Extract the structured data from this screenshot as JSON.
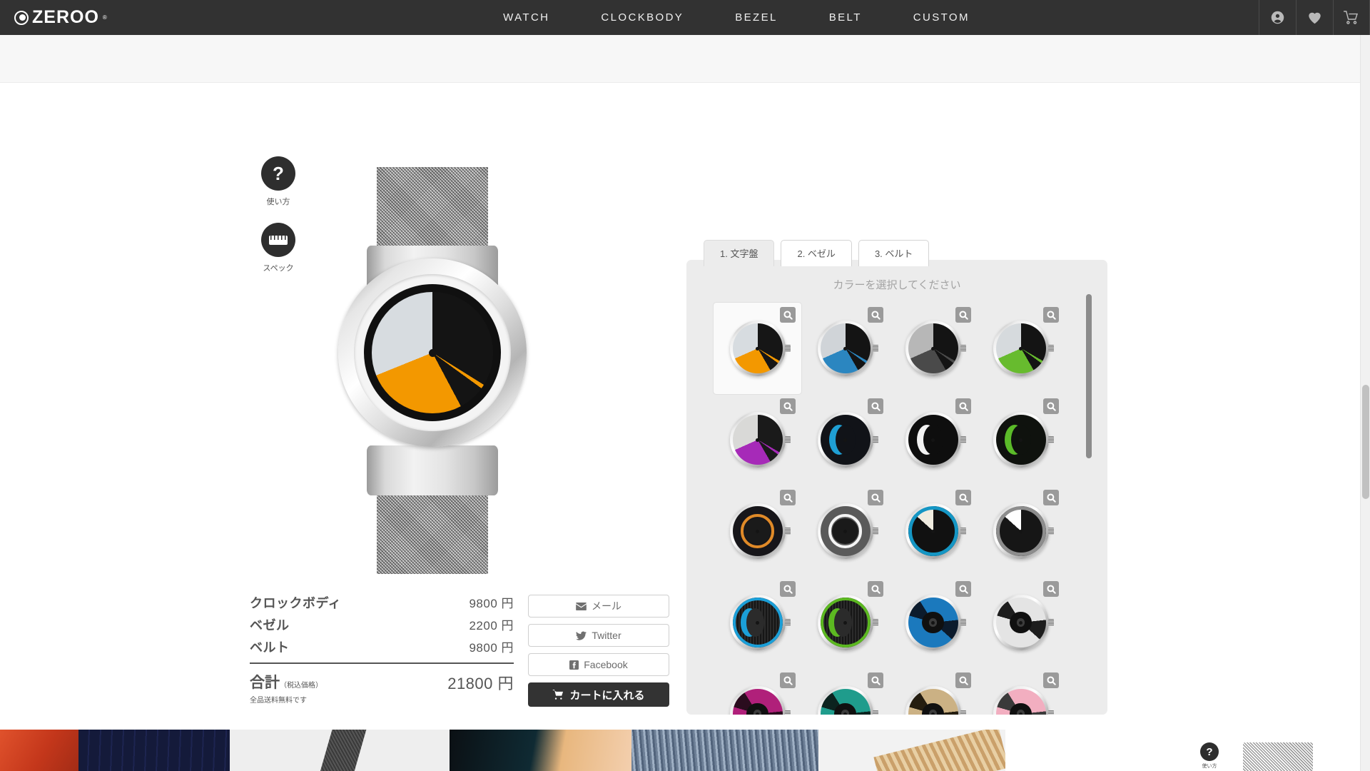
{
  "header": {
    "brand": "ZEROO",
    "brand_reg": "®",
    "nav": [
      {
        "label": "WATCH",
        "name": "nav-watch"
      },
      {
        "label": "CLOCKBODY",
        "name": "nav-clockbody"
      },
      {
        "label": "BEZEL",
        "name": "nav-bezel"
      },
      {
        "label": "BELT",
        "name": "nav-belt"
      },
      {
        "label": "CUSTOM",
        "name": "nav-custom"
      }
    ],
    "icons": [
      {
        "name": "account-icon"
      },
      {
        "name": "wishlist-heart-icon"
      },
      {
        "name": "shopping-cart-icon"
      }
    ]
  },
  "side_buttons": [
    {
      "glyph": "?",
      "label": "使い方",
      "name": "how-to-use-button"
    },
    {
      "glyph": "ruler",
      "label": "スペック",
      "name": "spec-button"
    }
  ],
  "product": {
    "dial_colors": {
      "light": "#d7dce0",
      "accent": "#f39800",
      "dark": "#141414"
    },
    "case_color": "#cfcfcf",
    "band_color": "#b0b0b0"
  },
  "pricing": {
    "rows": [
      {
        "label": "クロックボディ",
        "value": "9800 円"
      },
      {
        "label": "ベゼル",
        "value": "2200 円"
      },
      {
        "label": "ベルト",
        "value": "9800 円"
      }
    ],
    "total_label": "合計",
    "total_tax": "（税込価格）",
    "total_note": "全品送料無料です",
    "total_value": "21800 円"
  },
  "actions": {
    "share": [
      {
        "label": "メール",
        "icon": "mail-icon",
        "name": "share-mail-button"
      },
      {
        "label": "Twitter",
        "icon": "twitter-icon",
        "name": "share-twitter-button"
      },
      {
        "label": "Facebook",
        "icon": "facebook-icon",
        "name": "share-facebook-button"
      }
    ],
    "cart_label": "カートに入れる",
    "cart_icon": "cart-icon"
  },
  "selector": {
    "tabs": [
      {
        "label": "1. 文字盤",
        "name": "tab-dial",
        "active": true
      },
      {
        "label": "2. ベゼル",
        "name": "tab-bezel",
        "active": false
      },
      {
        "label": "3. ベルト",
        "name": "tab-belt",
        "active": false
      }
    ],
    "title": "カラーを選択してください",
    "swatches": [
      {
        "name": "swatch-orange-pie",
        "style": "pie",
        "accent": "#f39800",
        "light": "#d7dce0",
        "dark": "#161616",
        "selected": true
      },
      {
        "name": "swatch-blue-pie",
        "style": "pie",
        "accent": "#2b86c0",
        "light": "#d0d4d8",
        "dark": "#141414",
        "selected": false
      },
      {
        "name": "swatch-grey-pie",
        "style": "pie",
        "accent": "#4a4a4a",
        "light": "#b7b7b7",
        "dark": "#141414",
        "selected": false
      },
      {
        "name": "swatch-green-pie",
        "style": "pie",
        "accent": "#67bb2e",
        "light": "#d6dadd",
        "dark": "#141414",
        "selected": false
      },
      {
        "name": "swatch-purple-pie",
        "style": "pie",
        "accent": "#a62ab8",
        "light": "#d9d9d7",
        "dark": "#1a1a1a",
        "selected": false
      },
      {
        "name": "swatch-blue-moon",
        "style": "crescent",
        "accent": "#1f9fd4",
        "dark": "#111318",
        "selected": false
      },
      {
        "name": "swatch-white-moon",
        "style": "crescent",
        "accent": "#f2f2f2",
        "dark": "#0e0e0e",
        "selected": false
      },
      {
        "name": "swatch-green-moon",
        "style": "crescent",
        "accent": "#5bbb29",
        "dark": "#0f120e",
        "selected": false
      },
      {
        "name": "swatch-orange-ring",
        "style": "ring",
        "accent": "#e08a28",
        "dark": "#17161a",
        "selected": false
      },
      {
        "name": "swatch-white-ring",
        "style": "ring",
        "accent": "#f4f4f4",
        "dark": "#5a5a5a",
        "selected": false
      },
      {
        "name": "swatch-cyan-fan",
        "style": "fan",
        "accent": "#1596c4",
        "light": "#f0ece0",
        "dark": "#111111",
        "selected": false
      },
      {
        "name": "swatch-white-fan",
        "style": "fan",
        "accent": "#8d8d8d",
        "light": "#ffffff",
        "dark": "#161616",
        "selected": false
      },
      {
        "name": "swatch-cyan-stripe",
        "style": "stripe",
        "accent": "#1b9fd8",
        "dark": "#2b2b2b",
        "selected": false
      },
      {
        "name": "swatch-green-stripe",
        "style": "stripe",
        "accent": "#5cb821",
        "dark": "#2b2b2b",
        "selected": false
      },
      {
        "name": "swatch-blue-spiral",
        "style": "spiral",
        "accent": "#1b79bd",
        "dark": "#0c1b2c",
        "selected": false
      },
      {
        "name": "swatch-silver-spiral",
        "style": "spiral",
        "accent": "#e4e4e4",
        "dark": "#1d1d1d",
        "selected": false
      },
      {
        "name": "swatch-magenta-spiral",
        "style": "spiral",
        "accent": "#b0207a",
        "dark": "#2a0c1e",
        "selected": false
      },
      {
        "name": "swatch-teal-spiral",
        "style": "spiral",
        "accent": "#1f9c8c",
        "dark": "#0c231f",
        "selected": false
      },
      {
        "name": "swatch-gold-spiral",
        "style": "spiral",
        "accent": "#cbb184",
        "dark": "#241d10",
        "selected": false
      },
      {
        "name": "swatch-pink-spiral",
        "style": "spiral",
        "accent": "#f2aec0",
        "dark": "#3a3a3a",
        "selected": false
      }
    ]
  },
  "floating": {
    "glyph": "?",
    "label": "使い方"
  }
}
